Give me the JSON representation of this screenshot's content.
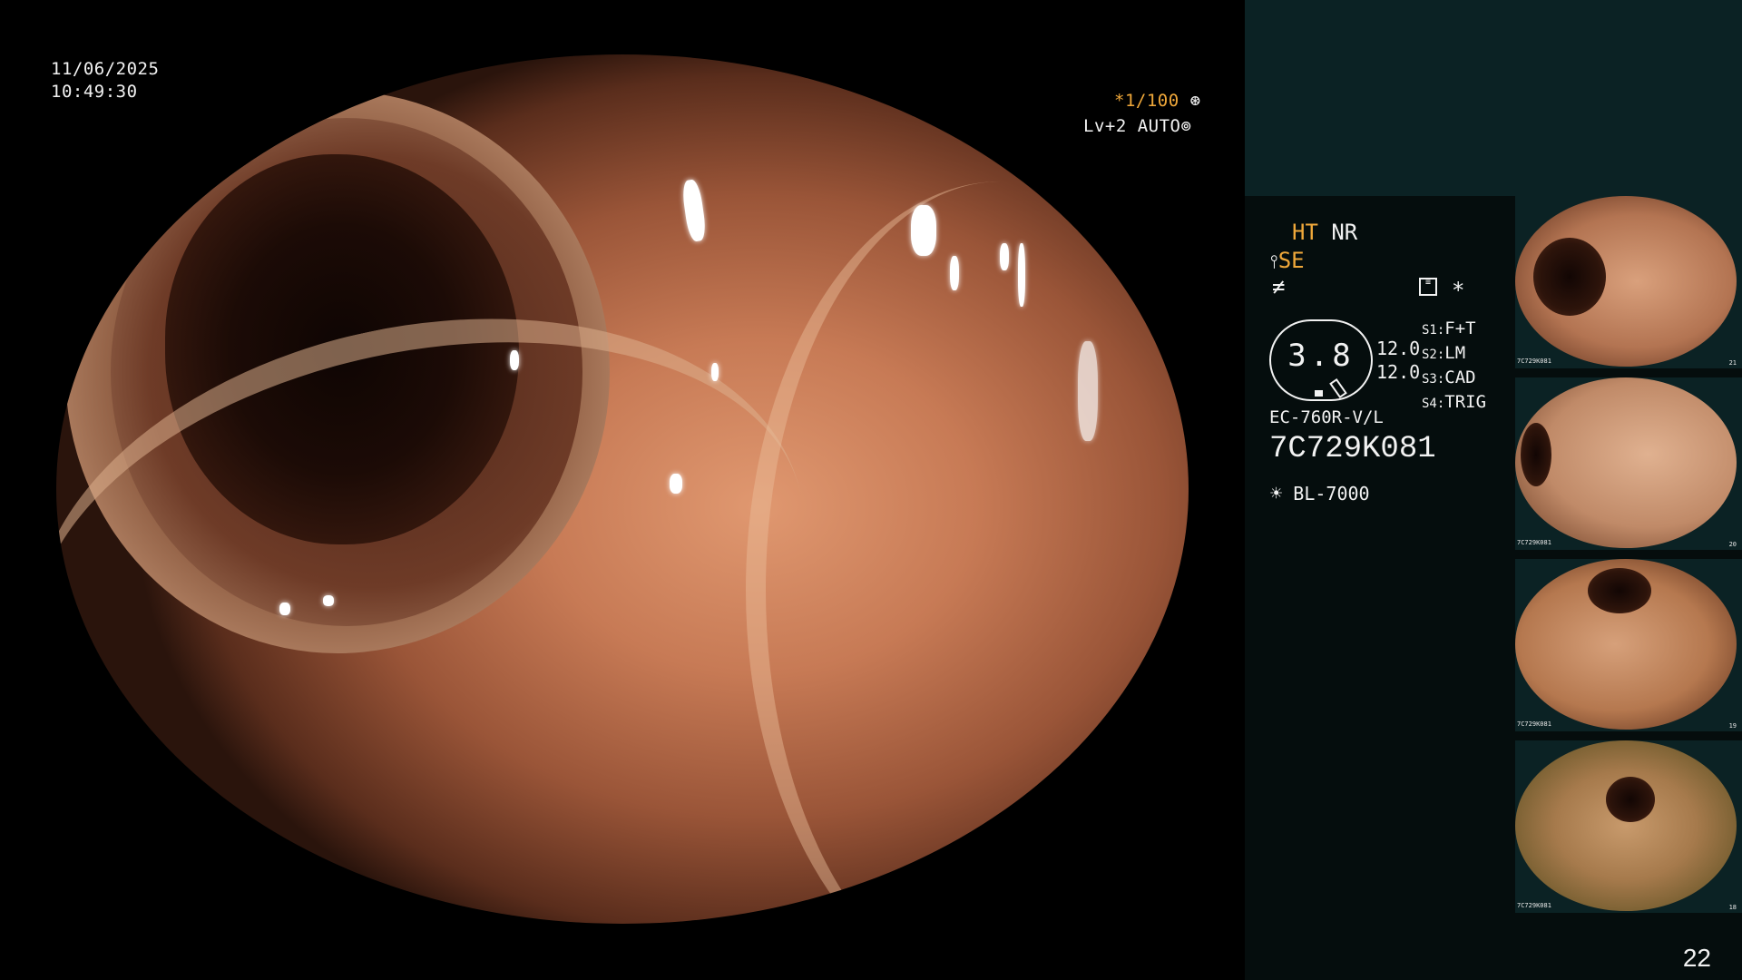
{
  "overlay": {
    "date": "11/06/2025",
    "time": "10:49:30",
    "shutter": "*1/100",
    "shutter_icon": "aperture-icon",
    "level": "Lv+2",
    "mode": "AUTO",
    "mode_icon": "iris-icon"
  },
  "panel": {
    "ht_label": "HT",
    "nr_label": "NR",
    "se_label": "SE",
    "se_icon": "structure-enhancement-icon",
    "color_icon": "color-enhance-icon",
    "settings_icon": "settings-grid-icon",
    "star_label": "*",
    "scale_value": "3.8",
    "scale_left": "12.0",
    "scale_left2": "12.0",
    "switches": [
      {
        "key": "S1:",
        "value": "F+T"
      },
      {
        "key": "S2:",
        "value": "LM"
      },
      {
        "key": "S3:",
        "value": "CAD"
      },
      {
        "key": "S4:",
        "value": "TRIG"
      }
    ],
    "scope_model": "EC-760R-V/L",
    "serial": "7C729K081",
    "light_icon": "light-source-icon",
    "light_source": "BL-7000"
  },
  "thumbnails": [
    {
      "caption": "7C729K081",
      "number": "21"
    },
    {
      "caption": "7C729K081",
      "number": "20"
    },
    {
      "caption": "7C729K081",
      "number": "19"
    },
    {
      "caption": "7C729K081",
      "number": "18"
    }
  ],
  "page_number": "22",
  "colors": {
    "accent_orange": "#f0a83a",
    "panel_top": "#0b2224",
    "panel_body": "#050d0d"
  }
}
